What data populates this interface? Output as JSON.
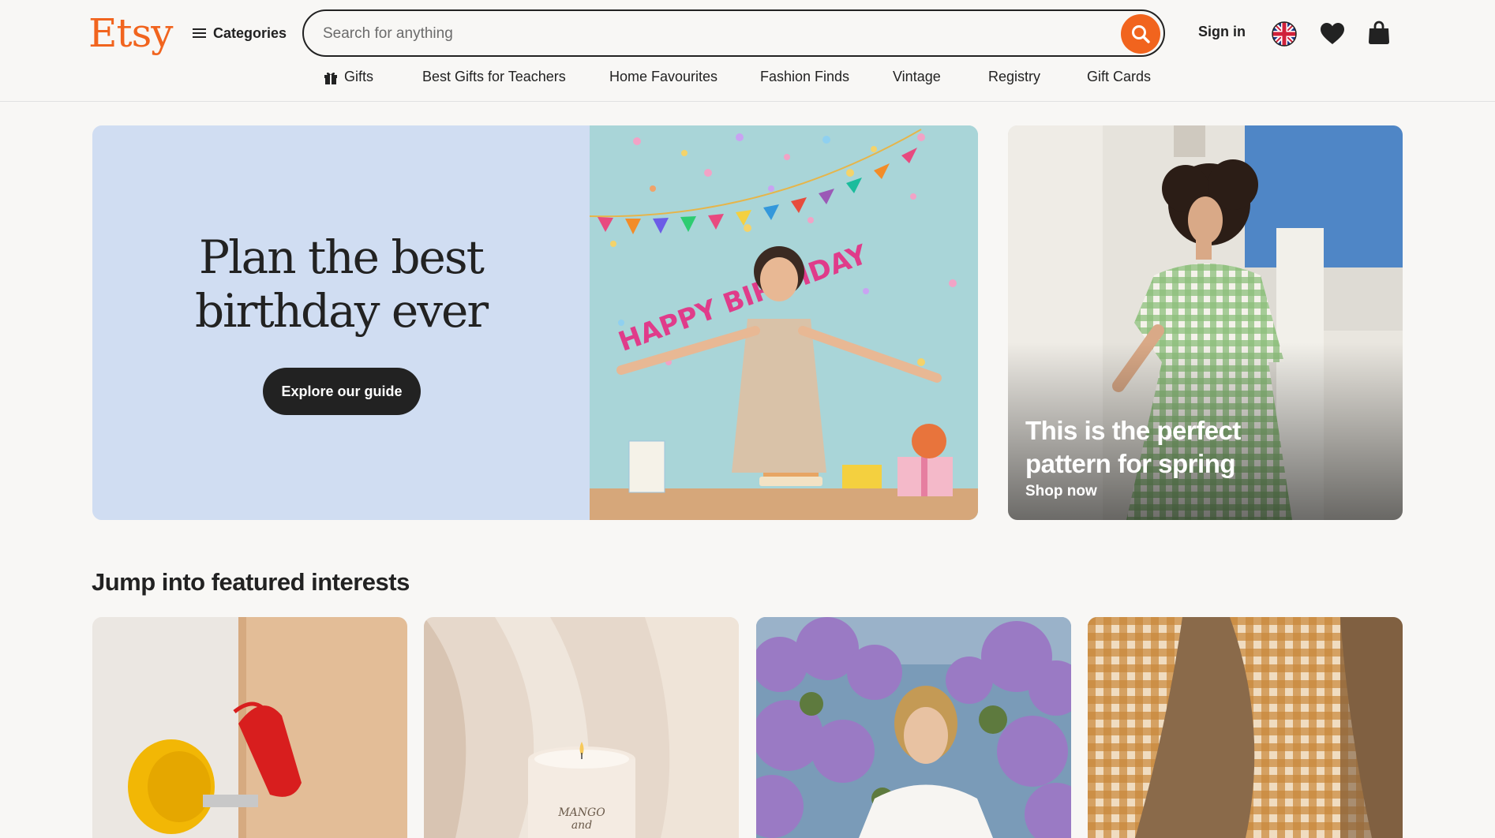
{
  "header": {
    "logo": "Etsy",
    "categories_label": "Categories",
    "search_placeholder": "Search for anything",
    "sign_in_label": "Sign in"
  },
  "nav": {
    "items": [
      {
        "label": "Gifts"
      },
      {
        "label": "Best Gifts for Teachers"
      },
      {
        "label": "Home Favourites"
      },
      {
        "label": "Fashion Finds"
      },
      {
        "label": "Vintage"
      },
      {
        "label": "Registry"
      },
      {
        "label": "Gift Cards"
      }
    ]
  },
  "hero": {
    "title_line1": "Plan the best",
    "title_line2": "birthday ever",
    "cta_label": "Explore our guide",
    "banner_text": "HAPPY BIRTHDAY"
  },
  "side_promo": {
    "title": "This is the perfect pattern for spring",
    "link_label": "Shop now"
  },
  "featured": {
    "title": "Jump into featured interests",
    "candle_label": "MANGO and"
  },
  "colors": {
    "brand": "#f1641e",
    "text": "#222222",
    "hero_bg": "#d0ddf2",
    "page_bg": "#f8f7f5"
  }
}
